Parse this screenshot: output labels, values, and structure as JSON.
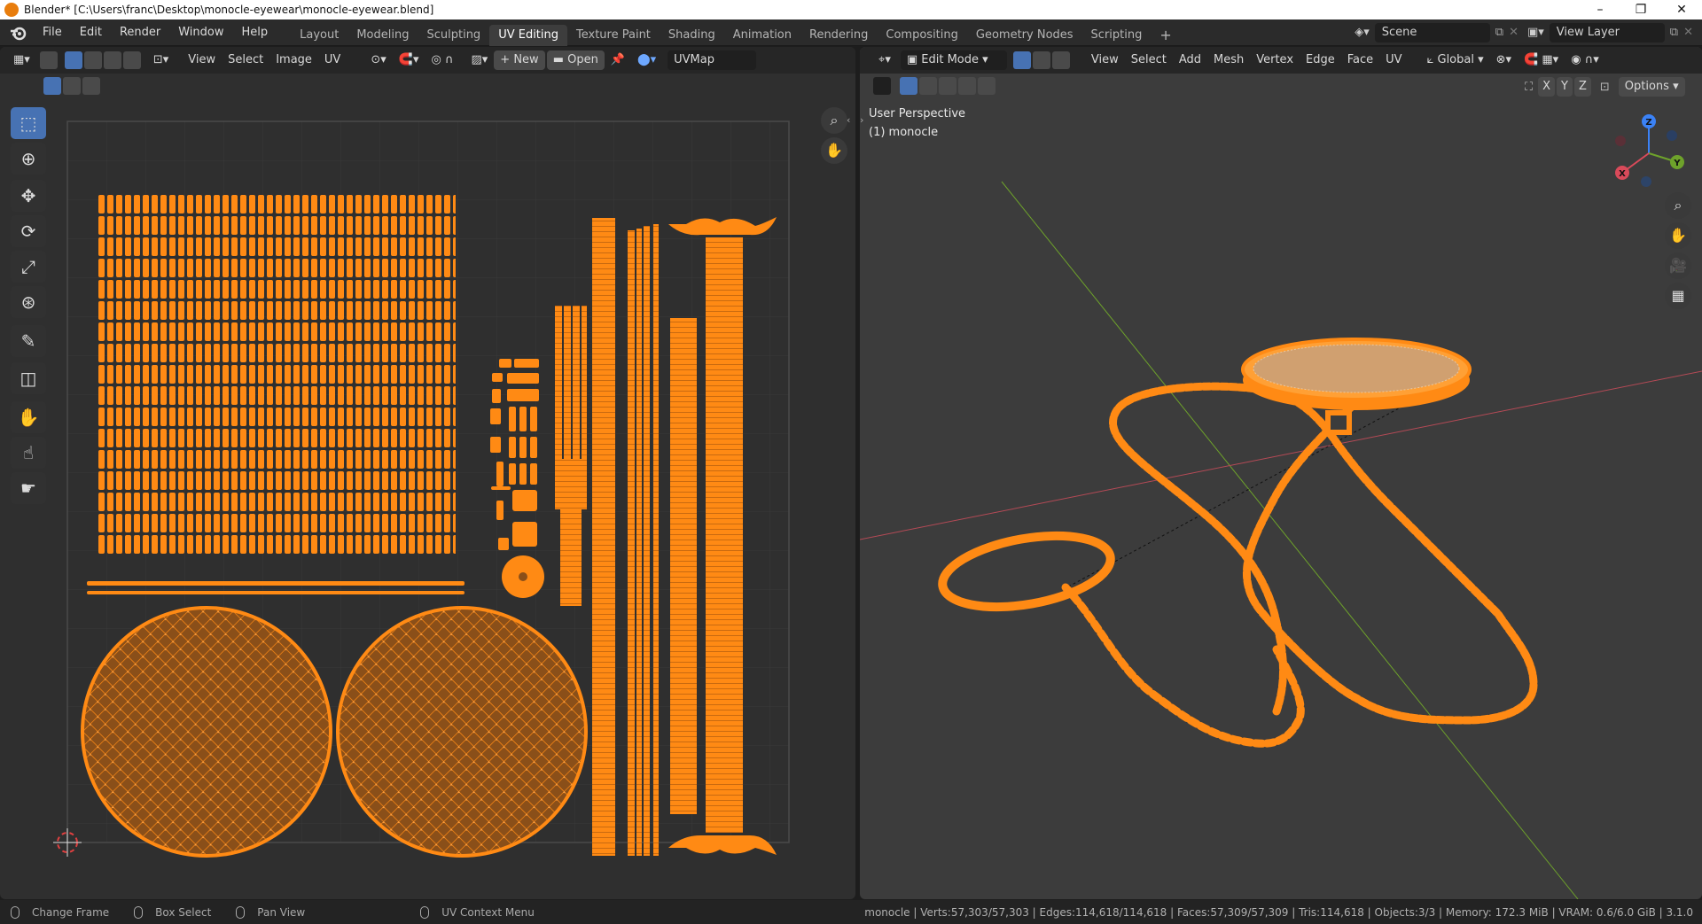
{
  "titlebar": {
    "title": "Blender* [C:\\Users\\franc\\Desktop\\monocle-eyewear\\monocle-eyewear.blend]",
    "minimize": "–",
    "maximize": "❐",
    "close": "✕"
  },
  "menus": [
    "File",
    "Edit",
    "Render",
    "Window",
    "Help"
  ],
  "workspaces": [
    "Layout",
    "Modeling",
    "Sculpting",
    "UV Editing",
    "Texture Paint",
    "Shading",
    "Animation",
    "Rendering",
    "Compositing",
    "Geometry Nodes",
    "Scripting"
  ],
  "active_workspace": "UV Editing",
  "add_workspace": "+",
  "scene": {
    "label": "Scene"
  },
  "view_layer": {
    "label": "View Layer"
  },
  "uv_editor": {
    "menus": [
      "View",
      "Select",
      "Image",
      "UV"
    ],
    "new_label": "New",
    "open_label": "Open",
    "uvmap": "UVMap"
  },
  "viewport": {
    "mode": "Edit Mode",
    "menus": [
      "View",
      "Select",
      "Add",
      "Mesh",
      "Vertex",
      "Edge",
      "Face",
      "UV"
    ],
    "orientation": "Global",
    "options": "Options",
    "axes": [
      "X",
      "Y",
      "Z"
    ],
    "perspective": "User Perspective",
    "object": "(1) monocle",
    "gizmo": {
      "x": "X",
      "y": "Y",
      "z": "Z"
    }
  },
  "colors": {
    "accent": "#4772b3",
    "selection": "#ff8a14",
    "x_axis": "#d94a5a",
    "y_axis": "#6ea22b",
    "z_axis": "#3b82f6"
  },
  "statusbar": {
    "hints": [
      "Change Frame",
      "Box Select",
      "Pan View",
      "UV Context Menu"
    ],
    "stats": "monocle | Verts:57,303/57,303 | Edges:114,618/114,618 | Faces:57,309/57,309 | Tris:114,618 | Objects:3/3 | Memory: 172.3 MiB | VRAM: 0.6/6.0 GiB | 3.1.0"
  }
}
